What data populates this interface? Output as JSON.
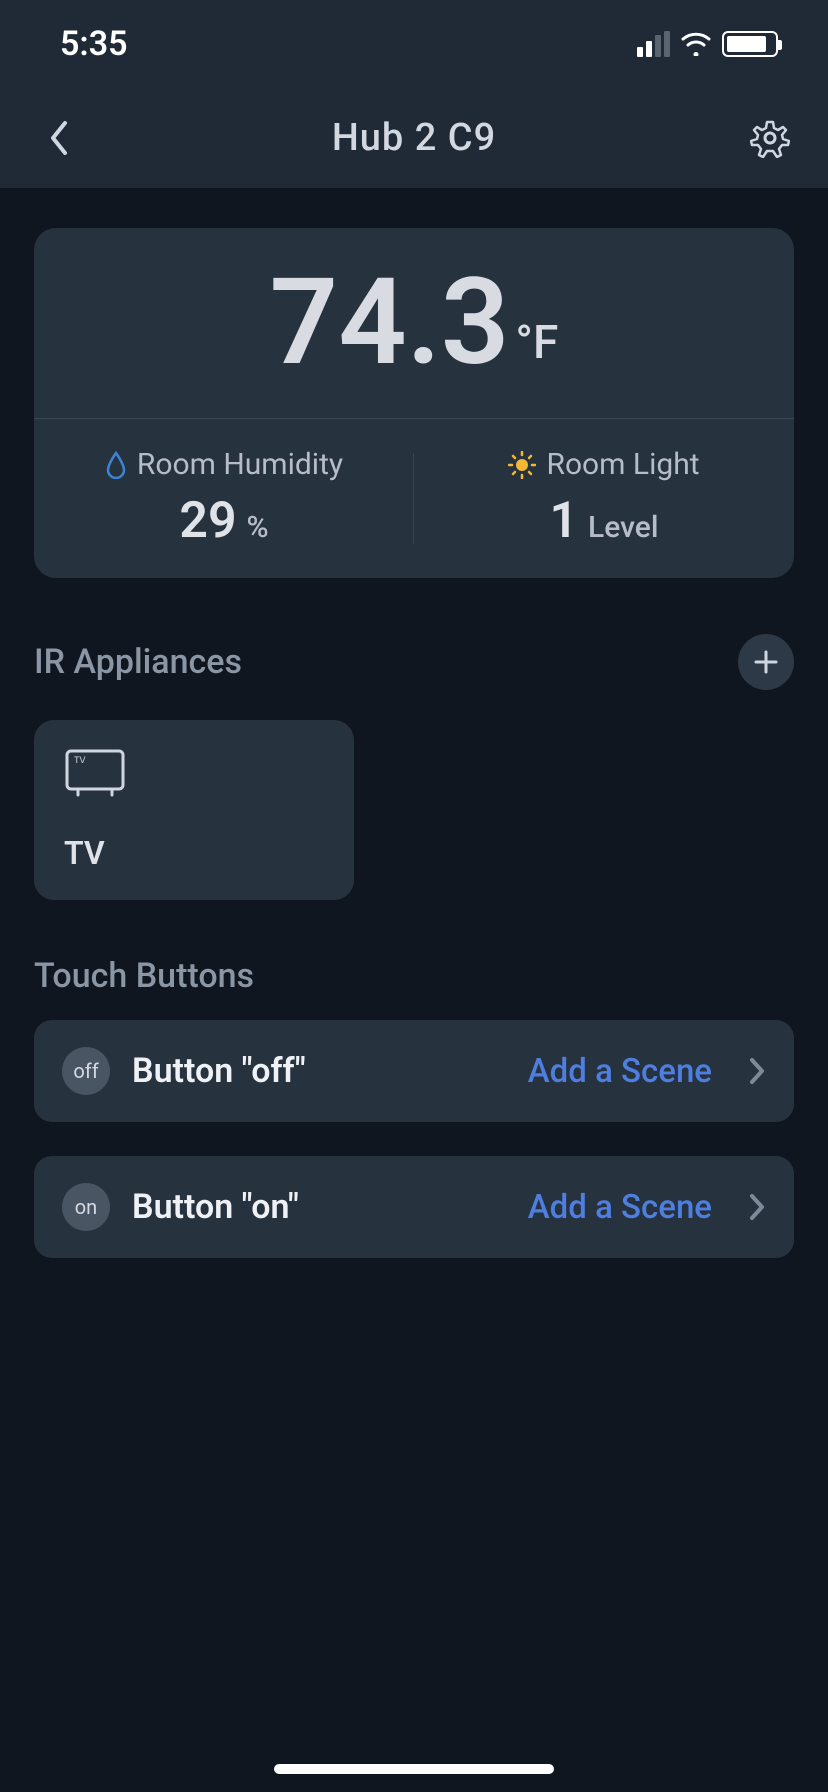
{
  "status": {
    "time": "5:35"
  },
  "header": {
    "title": "Hub 2 C9"
  },
  "sensor": {
    "temperature_value": "74.3",
    "temperature_unit": "°F",
    "humidity_label": "Room Humidity",
    "humidity_value": "29",
    "humidity_unit": "%",
    "light_label": "Room Light",
    "light_value": "1",
    "light_unit": "Level"
  },
  "sections": {
    "ir_title": "IR Appliances",
    "touch_title": "Touch Buttons"
  },
  "appliances": {
    "tv_label": "TV"
  },
  "touch": {
    "off_badge": "off",
    "off_label": "Button \"off\"",
    "off_action": "Add a Scene",
    "on_badge": "on",
    "on_label": "Button \"on\"",
    "on_action": "Add a Scene"
  }
}
